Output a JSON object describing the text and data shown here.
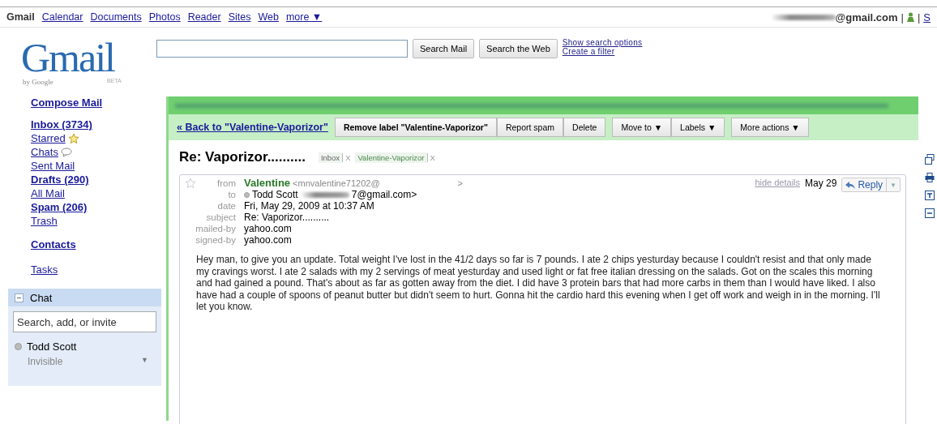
{
  "top_nav": {
    "brand": "Gmail",
    "links": [
      "Calendar",
      "Documents",
      "Photos",
      "Reader",
      "Sites",
      "Web",
      "more ▼"
    ],
    "account": "@gmail.com",
    "separator": "|",
    "cut_link": "S"
  },
  "logo": {
    "wordmark": "Gmail",
    "byline": "by Google",
    "tag": "BETA"
  },
  "search": {
    "buttons": [
      "Search Mail",
      "Search the Web"
    ],
    "links": [
      "Show search options",
      "Create a filter"
    ]
  },
  "sidebar": {
    "compose": "Compose Mail",
    "folders": [
      {
        "label": "Inbox (3734)",
        "unread": true
      },
      {
        "label": "Starred",
        "unread": false
      },
      {
        "label": "Chats",
        "unread": false
      },
      {
        "label": "Sent Mail",
        "unread": false
      },
      {
        "label": "Drafts (290)",
        "unread": true
      },
      {
        "label": "All Mail",
        "unread": false
      },
      {
        "label": "Spam (206)",
        "unread": true
      },
      {
        "label": "Trash",
        "unread": false
      }
    ],
    "contacts": "Contacts",
    "tasks": "Tasks"
  },
  "chat": {
    "title": "Chat",
    "expanded": true,
    "search_placeholder": "Search, add, or invite",
    "user": "Todd Scott",
    "status": "Invisible",
    "caret": "▼"
  },
  "toolbar": {
    "back_link": "« Back to \"Valentine-Vaporizor\"",
    "groups": [
      [
        "Remove label \"Valentine-Vaporizor\"",
        "Report spam",
        "Delete"
      ],
      [
        "Move to ▼",
        "Labels ▼"
      ],
      [
        "More actions ▼"
      ]
    ]
  },
  "conversation": {
    "subject": "Re: Vaporizor..........",
    "labels": [
      {
        "name": "Inbox",
        "remove": "X"
      },
      {
        "name": "Valentine-Vaporizor",
        "remove": "X"
      }
    ]
  },
  "message": {
    "starred": false,
    "from_label": "from",
    "sender": "Valentine",
    "sender_address_start": "<mnvalentine71202@",
    "sender_address_end": ">",
    "hide_details": "hide details",
    "date_short": "May 29",
    "reply": "Reply",
    "reply_menu": "▼",
    "to_label": "to",
    "to_name": "Todd Scott",
    "to_address_end": "7@gmail.com>",
    "details": [
      {
        "label": "date",
        "value": "Fri, May 29, 2009 at 10:37 AM"
      },
      {
        "label": "subject",
        "value": "Re: Vaporizor.........."
      },
      {
        "label": "mailed-by",
        "value": "yahoo.com"
      },
      {
        "label": "signed-by",
        "value": "yahoo.com"
      }
    ],
    "body": "Hey man, to give you an update. Total weight I've lost in the 41/2 days so far is 7 pounds. I ate 2 chips yesturday because I couldn't resist and that only made my cravings worst. I ate 2 salads with my 2 servings of meat yesturday and used light or fat free italian dressing on the salads. Got on the scales this morning and had gained a pound. That's about as far as gotten away from the diet. I did have 3 protein bars that had more carbs in them than I would have liked. I also have had a couple of spoons of peanut butter but didn't seem to hurt. Gonna hit the cardio hard this evening when I get off work and weigh in in the morning. I'll let you know."
  }
}
